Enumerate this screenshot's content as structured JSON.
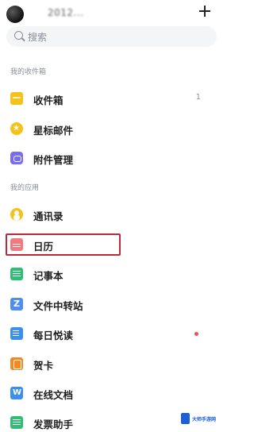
{
  "header": {
    "account": "2012...",
    "add_icon": "plus-icon"
  },
  "search": {
    "placeholder": "搜索",
    "icon": "search-icon"
  },
  "sections": {
    "mailbox": "我的收件箱",
    "apps": "我的应用"
  },
  "mailbox_items": [
    {
      "label": "收件箱",
      "icon": "folder-icon",
      "count": "1"
    },
    {
      "label": "星标邮件",
      "icon": "star-icon"
    },
    {
      "label": "附件管理",
      "icon": "attachment-icon"
    }
  ],
  "app_items": [
    {
      "label": "通讯录",
      "icon": "contacts-icon"
    },
    {
      "label": "日历",
      "icon": "calendar-icon"
    },
    {
      "label": "记事本",
      "icon": "notepad-icon"
    },
    {
      "label": "文件中转站",
      "icon": "file-transfer-icon"
    },
    {
      "label": "每日悦读",
      "icon": "daily-read-icon",
      "badge": "dot"
    },
    {
      "label": "贺卡",
      "icon": "greeting-card-icon"
    },
    {
      "label": "在线文档",
      "icon": "online-doc-icon"
    },
    {
      "label": "发票助手",
      "icon": "invoice-icon"
    }
  ],
  "watermark": {
    "text": "大师手游网"
  },
  "colors": {
    "accent_yellow": "#f5c21b",
    "highlight_border": "#c0283a",
    "unread_dot": "#e8505b"
  }
}
